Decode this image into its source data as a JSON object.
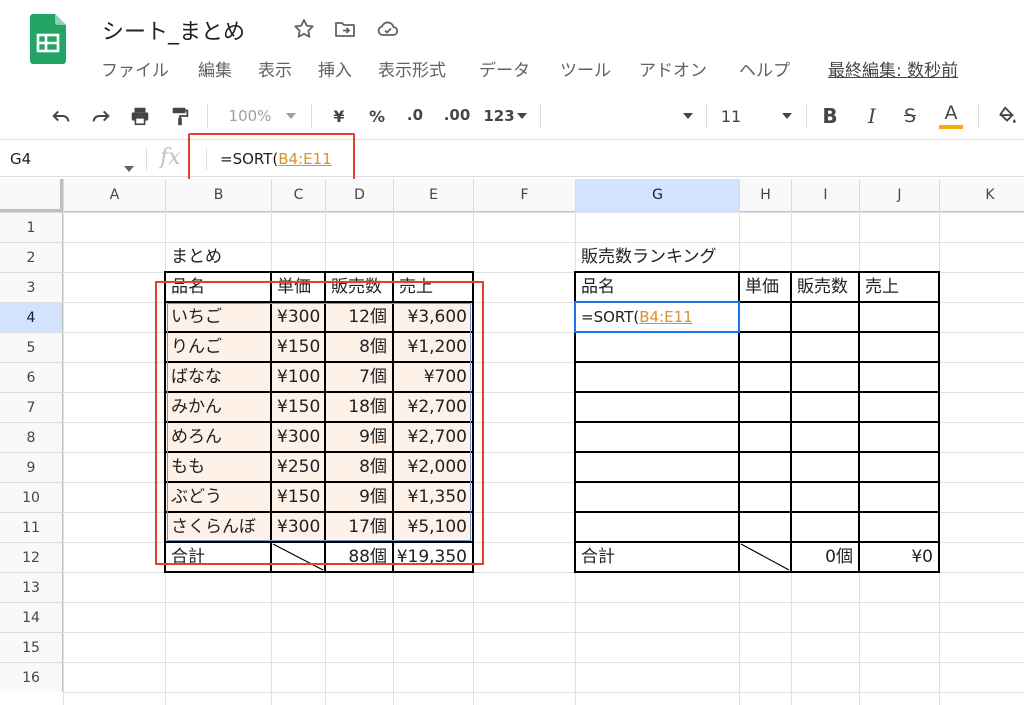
{
  "app": {
    "doc_title": "シート_まとめ",
    "last_edit": "最終編集: 数秒前",
    "menu": [
      "ファイル",
      "編集",
      "表示",
      "挿入",
      "表示形式",
      "データ",
      "ツール",
      "アドオン",
      "ヘルプ"
    ]
  },
  "toolbar": {
    "zoom": "100%",
    "currency": "¥",
    "percent": "%",
    "dec_decrease": ".0",
    "dec_increase": ".00",
    "more_formats": "123",
    "font_size": "11",
    "bold": "B",
    "italic": "I",
    "strike": "S",
    "text_color": "A",
    "text_color_hex": "#f9ab00"
  },
  "formula_bar": {
    "cell_ref": "G4",
    "fx": "fx",
    "formula_prefix": "=SORT(",
    "formula_range": "B4:E11"
  },
  "grid": {
    "columns": [
      "A",
      "B",
      "C",
      "D",
      "E",
      "F",
      "G",
      "H",
      "I",
      "J",
      "K"
    ],
    "rows": [
      "1",
      "2",
      "3",
      "4",
      "5",
      "6",
      "7",
      "8",
      "9",
      "10",
      "11",
      "12",
      "13",
      "14",
      "15",
      "16"
    ],
    "selected_column": "G",
    "selected_row": "4"
  },
  "summary_table": {
    "title": "まとめ",
    "headers": [
      "品名",
      "単価",
      "販売数",
      "売上"
    ],
    "rows": [
      [
        "いちご",
        "¥300",
        "12個",
        "¥3,600"
      ],
      [
        "りんご",
        "¥150",
        "8個",
        "¥1,200"
      ],
      [
        "ばなな",
        "¥100",
        "7個",
        "¥700"
      ],
      [
        "みかん",
        "¥150",
        "18個",
        "¥2,700"
      ],
      [
        "めろん",
        "¥300",
        "9個",
        "¥2,700"
      ],
      [
        "もも",
        "¥250",
        "8個",
        "¥2,000"
      ],
      [
        "ぶどう",
        "¥150",
        "9個",
        "¥1,350"
      ],
      [
        "さくらんぼ",
        "¥300",
        "17個",
        "¥5,100"
      ]
    ],
    "total": [
      "合計",
      "",
      "88個",
      "¥19,350"
    ]
  },
  "ranking_table": {
    "title": "販売数ランキング",
    "headers": [
      "品名",
      "単価",
      "販売数",
      "売上"
    ],
    "editing_prefix": "=SORT(",
    "editing_range": "B4:E11",
    "total": [
      "合計",
      "",
      "0個",
      "¥0"
    ]
  },
  "colors": {
    "highlight_fill": "#fdf1e8",
    "annotation_red": "#e5402e",
    "selection_blue": "#1a73e8",
    "sheets_green": "#188038"
  }
}
